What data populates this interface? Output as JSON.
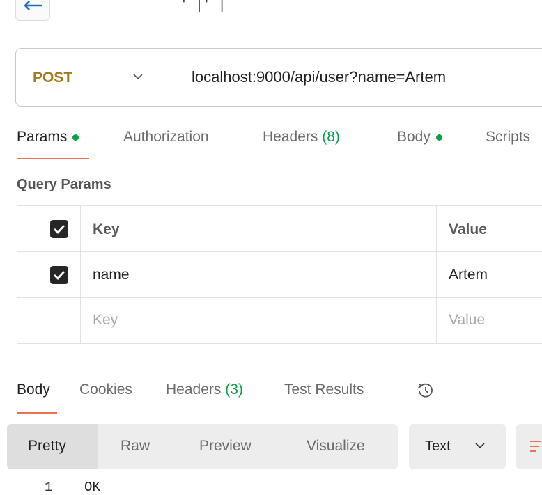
{
  "top": {
    "title_fragment": "' |' |"
  },
  "request": {
    "method": "POST",
    "url": "localhost:9000/api/user?name=Artem",
    "tabs": [
      {
        "label": "Params"
      },
      {
        "label": "Authorization"
      },
      {
        "label": "Headers",
        "count": "(8)"
      },
      {
        "label": "Body"
      },
      {
        "label": "Scripts"
      }
    ]
  },
  "query_params": {
    "title": "Query Params",
    "columns": {
      "key": "Key",
      "value": "Value"
    },
    "rows": [
      {
        "key": "name",
        "value": "Artem",
        "checked": true
      }
    ],
    "placeholder": {
      "key": "Key",
      "value": "Value"
    }
  },
  "response": {
    "tabs": [
      {
        "label": "Body"
      },
      {
        "label": "Cookies"
      },
      {
        "label": "Headers",
        "count": "(3)"
      },
      {
        "label": "Test Results"
      }
    ],
    "views": [
      "Pretty",
      "Raw",
      "Preview",
      "Visualize"
    ],
    "format": "Text",
    "body_lines": [
      {
        "number": "1",
        "text": "OK"
      }
    ]
  },
  "icons": {
    "back": "arrow-left-icon",
    "method_dropdown": "chevron-down-icon",
    "history": "history-icon",
    "format_dropdown": "chevron-down-icon",
    "wrap": "filter-lines-icon"
  },
  "colors": {
    "accent": "#e8734d",
    "status_green": "#0c9f4a",
    "method_post": "#a5781c"
  }
}
